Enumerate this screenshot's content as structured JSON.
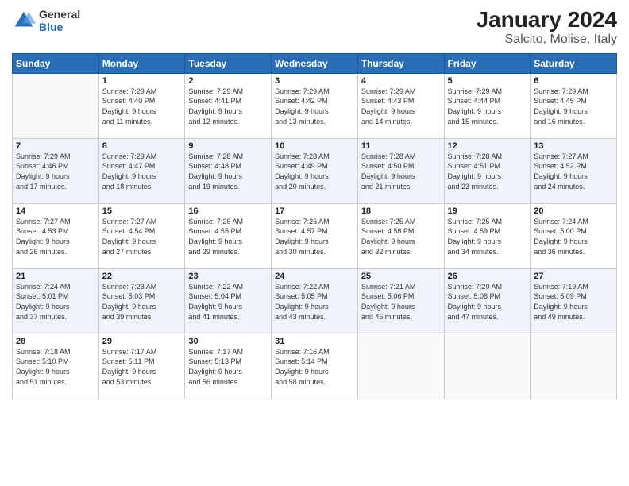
{
  "header": {
    "logo_general": "General",
    "logo_blue": "Blue",
    "title": "January 2024",
    "subtitle": "Salcito, Molise, Italy"
  },
  "calendar": {
    "days_of_week": [
      "Sunday",
      "Monday",
      "Tuesday",
      "Wednesday",
      "Thursday",
      "Friday",
      "Saturday"
    ],
    "weeks": [
      [
        {
          "day": "",
          "info": ""
        },
        {
          "day": "1",
          "info": "Sunrise: 7:29 AM\nSunset: 4:40 PM\nDaylight: 9 hours\nand 11 minutes."
        },
        {
          "day": "2",
          "info": "Sunrise: 7:29 AM\nSunset: 4:41 PM\nDaylight: 9 hours\nand 12 minutes."
        },
        {
          "day": "3",
          "info": "Sunrise: 7:29 AM\nSunset: 4:42 PM\nDaylight: 9 hours\nand 13 minutes."
        },
        {
          "day": "4",
          "info": "Sunrise: 7:29 AM\nSunset: 4:43 PM\nDaylight: 9 hours\nand 14 minutes."
        },
        {
          "day": "5",
          "info": "Sunrise: 7:29 AM\nSunset: 4:44 PM\nDaylight: 9 hours\nand 15 minutes."
        },
        {
          "day": "6",
          "info": "Sunrise: 7:29 AM\nSunset: 4:45 PM\nDaylight: 9 hours\nand 16 minutes."
        }
      ],
      [
        {
          "day": "7",
          "info": "Sunrise: 7:29 AM\nSunset: 4:46 PM\nDaylight: 9 hours\nand 17 minutes."
        },
        {
          "day": "8",
          "info": "Sunrise: 7:29 AM\nSunset: 4:47 PM\nDaylight: 9 hours\nand 18 minutes."
        },
        {
          "day": "9",
          "info": "Sunrise: 7:28 AM\nSunset: 4:48 PM\nDaylight: 9 hours\nand 19 minutes."
        },
        {
          "day": "10",
          "info": "Sunrise: 7:28 AM\nSunset: 4:49 PM\nDaylight: 9 hours\nand 20 minutes."
        },
        {
          "day": "11",
          "info": "Sunrise: 7:28 AM\nSunset: 4:50 PM\nDaylight: 9 hours\nand 21 minutes."
        },
        {
          "day": "12",
          "info": "Sunrise: 7:28 AM\nSunset: 4:51 PM\nDaylight: 9 hours\nand 23 minutes."
        },
        {
          "day": "13",
          "info": "Sunrise: 7:27 AM\nSunset: 4:52 PM\nDaylight: 9 hours\nand 24 minutes."
        }
      ],
      [
        {
          "day": "14",
          "info": "Sunrise: 7:27 AM\nSunset: 4:53 PM\nDaylight: 9 hours\nand 26 minutes."
        },
        {
          "day": "15",
          "info": "Sunrise: 7:27 AM\nSunset: 4:54 PM\nDaylight: 9 hours\nand 27 minutes."
        },
        {
          "day": "16",
          "info": "Sunrise: 7:26 AM\nSunset: 4:55 PM\nDaylight: 9 hours\nand 29 minutes."
        },
        {
          "day": "17",
          "info": "Sunrise: 7:26 AM\nSunset: 4:57 PM\nDaylight: 9 hours\nand 30 minutes."
        },
        {
          "day": "18",
          "info": "Sunrise: 7:25 AM\nSunset: 4:58 PM\nDaylight: 9 hours\nand 32 minutes."
        },
        {
          "day": "19",
          "info": "Sunrise: 7:25 AM\nSunset: 4:59 PM\nDaylight: 9 hours\nand 34 minutes."
        },
        {
          "day": "20",
          "info": "Sunrise: 7:24 AM\nSunset: 5:00 PM\nDaylight: 9 hours\nand 36 minutes."
        }
      ],
      [
        {
          "day": "21",
          "info": "Sunrise: 7:24 AM\nSunset: 5:01 PM\nDaylight: 9 hours\nand 37 minutes."
        },
        {
          "day": "22",
          "info": "Sunrise: 7:23 AM\nSunset: 5:03 PM\nDaylight: 9 hours\nand 39 minutes."
        },
        {
          "day": "23",
          "info": "Sunrise: 7:22 AM\nSunset: 5:04 PM\nDaylight: 9 hours\nand 41 minutes."
        },
        {
          "day": "24",
          "info": "Sunrise: 7:22 AM\nSunset: 5:05 PM\nDaylight: 9 hours\nand 43 minutes."
        },
        {
          "day": "25",
          "info": "Sunrise: 7:21 AM\nSunset: 5:06 PM\nDaylight: 9 hours\nand 45 minutes."
        },
        {
          "day": "26",
          "info": "Sunrise: 7:20 AM\nSunset: 5:08 PM\nDaylight: 9 hours\nand 47 minutes."
        },
        {
          "day": "27",
          "info": "Sunrise: 7:19 AM\nSunset: 5:09 PM\nDaylight: 9 hours\nand 49 minutes."
        }
      ],
      [
        {
          "day": "28",
          "info": "Sunrise: 7:18 AM\nSunset: 5:10 PM\nDaylight: 9 hours\nand 51 minutes."
        },
        {
          "day": "29",
          "info": "Sunrise: 7:17 AM\nSunset: 5:11 PM\nDaylight: 9 hours\nand 53 minutes."
        },
        {
          "day": "30",
          "info": "Sunrise: 7:17 AM\nSunset: 5:13 PM\nDaylight: 9 hours\nand 56 minutes."
        },
        {
          "day": "31",
          "info": "Sunrise: 7:16 AM\nSunset: 5:14 PM\nDaylight: 9 hours\nand 58 minutes."
        },
        {
          "day": "",
          "info": ""
        },
        {
          "day": "",
          "info": ""
        },
        {
          "day": "",
          "info": ""
        }
      ]
    ]
  }
}
